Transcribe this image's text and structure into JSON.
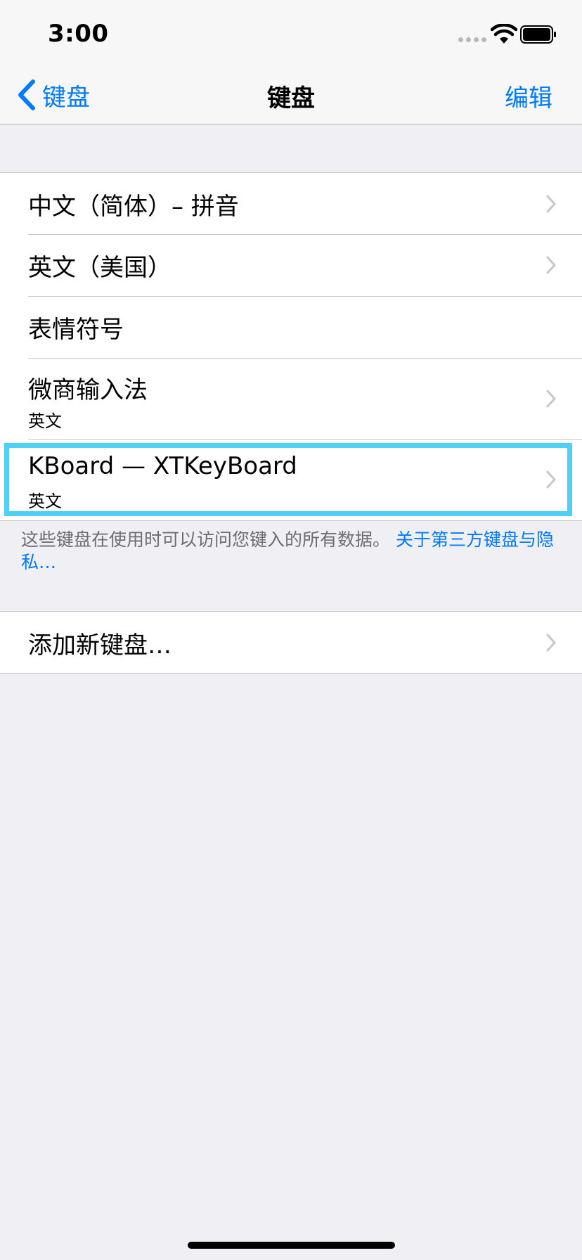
{
  "status_bar": {
    "time": "3:00",
    "icons": [
      "cellular-dots-icon",
      "wifi-icon",
      "battery-icon"
    ]
  },
  "nav": {
    "back_label": "键盘",
    "title": "键盘",
    "edit_label": "编辑"
  },
  "keyboards": [
    {
      "title": "中文（简体）– 拼音",
      "subtitle": "",
      "chevron": true
    },
    {
      "title": "英文（美国）",
      "subtitle": "",
      "chevron": true
    },
    {
      "title": "表情符号",
      "subtitle": "",
      "chevron": false
    },
    {
      "title": "微商输入法",
      "subtitle": "英文",
      "chevron": true
    },
    {
      "title": "KBoard — XTKeyBoard",
      "subtitle": "英文",
      "chevron": true
    }
  ],
  "footer": {
    "text": "这些键盘在使用时可以访问您键入的所有数据。",
    "link": "关于第三方键盘与隐私…"
  },
  "add_keyboard": {
    "label": "添加新键盘…"
  },
  "colors": {
    "accent": "#007aff",
    "highlight": "#4fd0f7",
    "background": "#efeff4"
  }
}
